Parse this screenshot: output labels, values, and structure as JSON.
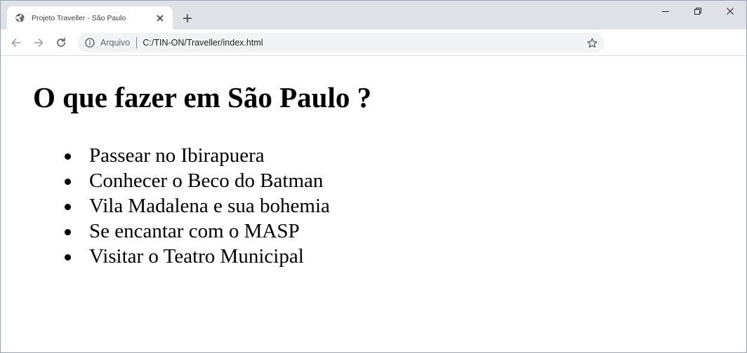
{
  "browser": {
    "tab": {
      "title": "Projeto Traveller - São Paulo",
      "favicon": "globe-icon"
    },
    "new_tab": "+",
    "address_bar": {
      "security_label": "Arquivo",
      "url": "C:/TIN-ON/Traveller/index.html"
    }
  },
  "page": {
    "heading": "O que fazer em São Paulo ?",
    "items": [
      "Passear no Ibirapuera",
      "Conhecer o Beco do Batman",
      "Vila Madalena e sua bohemia",
      "Se encantar com o MASP",
      "Visitar o Teatro Municipal"
    ]
  }
}
